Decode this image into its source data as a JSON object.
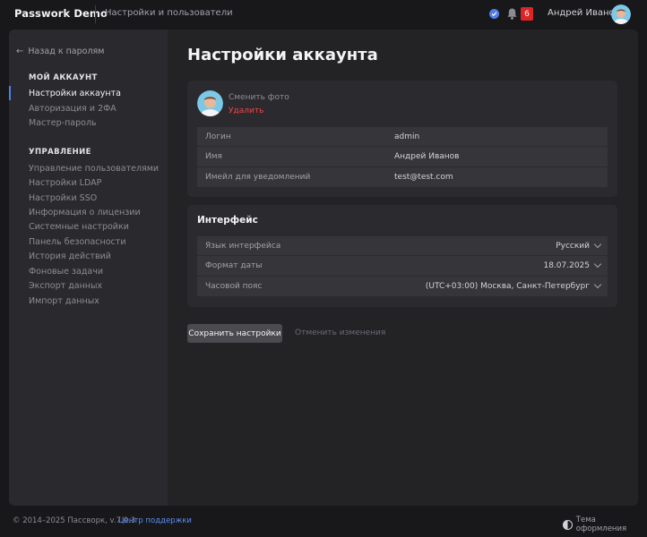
{
  "app": {
    "title": "Passwork Demo",
    "section": "Настройки и пользователи"
  },
  "header": {
    "notifications_count": "6",
    "user_name": "Андрей Иванов"
  },
  "sidebar": {
    "back_label": "Назад к паролям",
    "my_account_header": "МОЙ АККАУНТ",
    "my_account_items": [
      {
        "label": "Настройки аккаунта",
        "active": true
      },
      {
        "label": "Авторизация и 2ФА"
      },
      {
        "label": "Мастер-пароль"
      }
    ],
    "management_header": "УПРАВЛЕНИЕ",
    "management_items": [
      {
        "label": "Управление пользователями"
      },
      {
        "label": "Настройки LDAP"
      },
      {
        "label": "Настройки SSO"
      },
      {
        "label": "Информация о лицензии"
      },
      {
        "label": "Системные настройки"
      },
      {
        "label": "Панель безопасности"
      },
      {
        "label": "История действий"
      },
      {
        "label": "Фоновые задачи"
      },
      {
        "label": "Экспорт данных"
      },
      {
        "label": "Импорт данных"
      }
    ]
  },
  "main": {
    "title": "Настройки аккаунта",
    "profile": {
      "change_photo": "Сменить фото",
      "delete_photo": "Удалить",
      "fields": [
        {
          "label": "Логин",
          "value": "admin"
        },
        {
          "label": "Имя",
          "value": "Андрей Иванов"
        },
        {
          "label": "Имейл для уведомлений",
          "value": "test@test.com"
        }
      ]
    },
    "interface": {
      "title": "Интерфейс",
      "settings": [
        {
          "label": "Язык интерфейса",
          "value": "Русский"
        },
        {
          "label": "Формат даты",
          "value": "18.07.2025"
        },
        {
          "label": "Часовой пояс",
          "value": "(UTC+03:00) Москва, Санкт-Петербург"
        }
      ]
    },
    "save_label": "Сохранить настройки",
    "cancel_label": "Отменить изменения"
  },
  "footer": {
    "copyright": "© 2014–2025 Пассворк, v.7.0.3",
    "support_link": "Центр поддержки",
    "theme_label": "Тема оформления"
  },
  "colors": {
    "accent": "#4f7fe6",
    "danger": "#ef4444",
    "badge": "#dc2626",
    "link": "#5b8def"
  }
}
